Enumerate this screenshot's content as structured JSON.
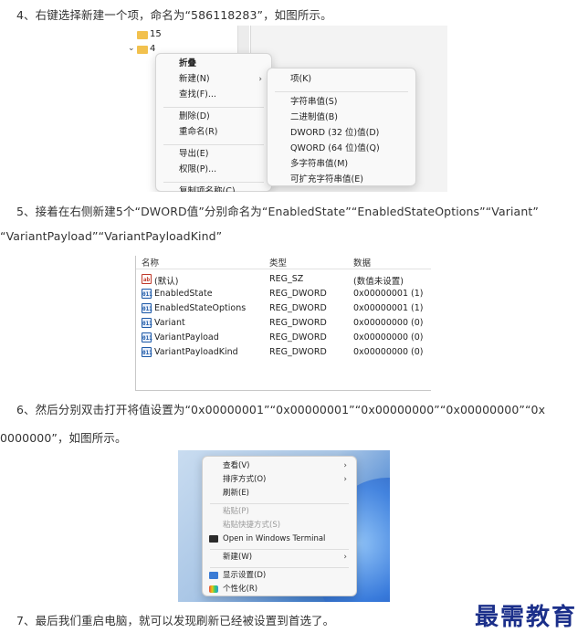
{
  "steps": {
    "s4": "4、右键选择新建一个项，命名为“586118283”，如图所示。",
    "s5_line1": "5、接着在右侧新建5个“DWORD值”分别命名为“EnabledState”“EnabledStateOptions”“Variant”",
    "s5_line2": "“VariantPayload”“VariantPayloadKind”",
    "s6_line1": "6、然后分别双击打开将值设置为“0x00000001”“0x00000001”“0x00000000”“0x00000000”“0x",
    "s6_line2": "0000000”，如图所示。",
    "s7": "7、最后我们重启电脑，就可以发现刷新已经被设置到首选了。"
  },
  "shot1": {
    "tree": [
      "15",
      "4"
    ],
    "context_menu": [
      {
        "label": "折叠",
        "bold": true
      },
      {
        "label": "新建(N)",
        "submenu": true
      },
      {
        "label": "查找(F)..."
      },
      {
        "sep": true
      },
      {
        "label": "删除(D)"
      },
      {
        "label": "重命名(R)"
      },
      {
        "sep": true
      },
      {
        "label": "导出(E)"
      },
      {
        "label": "权限(P)..."
      },
      {
        "sep": true
      },
      {
        "label": "复制项名称(C)"
      }
    ],
    "submenu": [
      {
        "label": "项(K)"
      },
      {
        "sep": true
      },
      {
        "label": "字符串值(S)"
      },
      {
        "label": "二进制值(B)"
      },
      {
        "label": "DWORD (32 位)值(D)"
      },
      {
        "label": "QWORD (64 位)值(Q)"
      },
      {
        "label": "多字符串值(M)"
      },
      {
        "label": "可扩充字符串值(E)"
      }
    ],
    "submenu_arrow": "›"
  },
  "shot2": {
    "headers": {
      "name": "名称",
      "type": "类型",
      "data": "数据"
    },
    "rows": [
      {
        "icon": "ab",
        "kind": "sz",
        "name": "(默认)",
        "type": "REG_SZ",
        "data": "(数值未设置)"
      },
      {
        "icon": "011",
        "kind": "dw",
        "name": "EnabledState",
        "type": "REG_DWORD",
        "data": "0x00000001 (1)"
      },
      {
        "icon": "011",
        "kind": "dw",
        "name": "EnabledStateOptions",
        "type": "REG_DWORD",
        "data": "0x00000001 (1)"
      },
      {
        "icon": "011",
        "kind": "dw",
        "name": "Variant",
        "type": "REG_DWORD",
        "data": "0x00000000 (0)"
      },
      {
        "icon": "011",
        "kind": "dw",
        "name": "VariantPayload",
        "type": "REG_DWORD",
        "data": "0x00000000 (0)"
      },
      {
        "icon": "011",
        "kind": "dw",
        "name": "VariantPayloadKind",
        "type": "REG_DWORD",
        "data": "0x00000000 (0)"
      }
    ]
  },
  "shot3": {
    "menu": [
      {
        "label": "查看(V)",
        "submenu": true
      },
      {
        "label": "排序方式(O)",
        "submenu": true
      },
      {
        "label": "刷新(E)"
      },
      {
        "sep": true
      },
      {
        "label": "粘贴(P)",
        "disabled": true
      },
      {
        "label": "粘贴快捷方式(S)",
        "disabled": true
      },
      {
        "label": "Open in Windows Terminal",
        "icon": "terminal-icon"
      },
      {
        "sep": true
      },
      {
        "label": "新建(W)",
        "submenu": true
      },
      {
        "sep": true
      },
      {
        "label": "显示设置(D)",
        "icon": "display-icon"
      },
      {
        "label": "个性化(R)",
        "icon": "personalize-icon"
      }
    ]
  },
  "watermark": "最需教育",
  "colors": {
    "folder": "#f2c14e",
    "dword_icon": "#1e5aa8",
    "sz_icon": "#c0392b",
    "watermark": "#1b2f8a"
  }
}
